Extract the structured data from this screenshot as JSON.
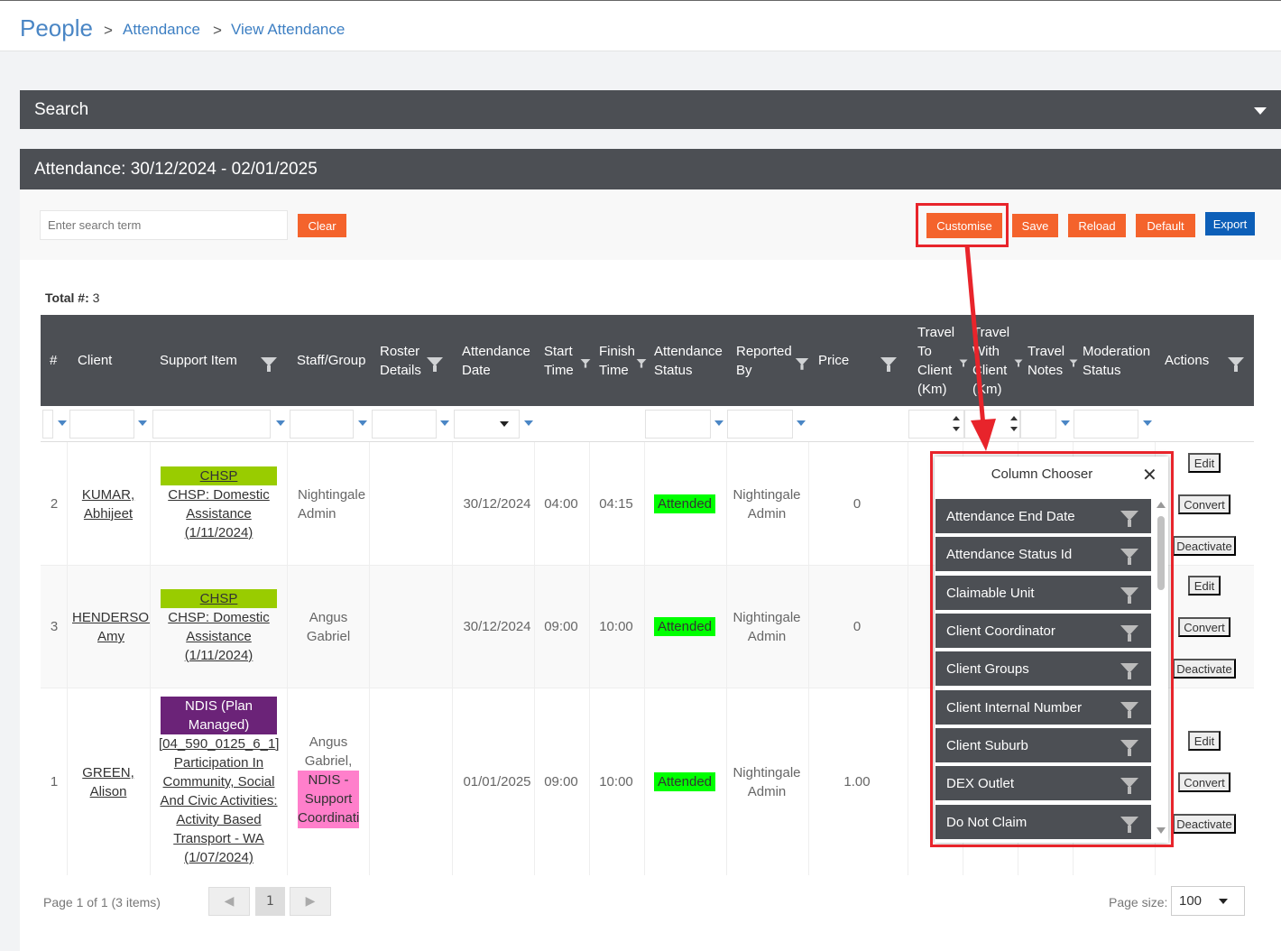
{
  "breadcrumb": {
    "root": "People",
    "items": [
      "Attendance",
      "View Attendance"
    ],
    "separator": ">"
  },
  "search_panel": {
    "title": "Search"
  },
  "attendance_panel": {
    "title": "Attendance: 30/12/2024 - 02/01/2025"
  },
  "toolbar": {
    "search_placeholder": "Enter search term",
    "clear_label": "Clear",
    "customise_label": "Customise",
    "save_label": "Save",
    "reload_label": "Reload",
    "default_label": "Default",
    "export_label": "Export"
  },
  "total": {
    "label": "Total #:",
    "value": "3"
  },
  "columns": [
    {
      "label": "#"
    },
    {
      "label": "Client"
    },
    {
      "label": "Support Item"
    },
    {
      "label": "Staff/Group"
    },
    {
      "label": "Roster Details"
    },
    {
      "label": "Attendance Date"
    },
    {
      "label": "Start Time"
    },
    {
      "label": "Finish Time"
    },
    {
      "label": "Attendance Status"
    },
    {
      "label": "Reported By"
    },
    {
      "label": "Price"
    },
    {
      "label": "Travel To Client (Km)"
    },
    {
      "label": "Travel With Client (Km)"
    },
    {
      "label": "Travel Notes"
    },
    {
      "label": "Moderation Status"
    },
    {
      "label": "Actions"
    }
  ],
  "rows": [
    {
      "num": "2",
      "client": "KUMAR, Abhijeet",
      "funding": "CHSP",
      "support": "CHSP: Domestic Assistance (1/11/2024)",
      "staff": "Nightingale Admin",
      "staff_tag": "",
      "date": "30/12/2024",
      "start": "04:00",
      "finish": "04:15",
      "status": "Attended",
      "reported": "Nightingale Admin",
      "price": "0"
    },
    {
      "num": "3",
      "client": "HENDERSON, Amy",
      "funding": "CHSP",
      "support": "CHSP: Domestic Assistance (1/11/2024)",
      "staff": "Angus Gabriel",
      "staff_tag": "",
      "date": "30/12/2024",
      "start": "09:00",
      "finish": "10:00",
      "status": "Attended",
      "reported": "Nightingale Admin",
      "price": "0"
    },
    {
      "num": "1",
      "client": "GREEN, Alison",
      "funding": "NDIS (Plan Managed)",
      "support": "[04_590_0125_6_1] Participation In Community, Social And Civic Activities: Activity Based Transport - WA (1/07/2024)",
      "staff": "Angus Gabriel,",
      "staff_tag": "NDIS - Support Coordination",
      "date": "01/01/2025",
      "start": "09:00",
      "finish": "10:00",
      "status": "Attended",
      "reported": "Nightingale Admin",
      "price": "1.00"
    }
  ],
  "actions": {
    "edit": "Edit",
    "convert": "Convert",
    "deactivate": "Deactivate"
  },
  "column_chooser": {
    "title": "Column Chooser",
    "items": [
      "Attendance End Date",
      "Attendance Status Id",
      "Claimable Unit",
      "Client Coordinator",
      "Client Groups",
      "Client Internal Number",
      "Client Suburb",
      "DEX Outlet",
      "Do Not Claim"
    ]
  },
  "pager": {
    "summary": "Page 1 of 1 (3 items)",
    "current_page": "1",
    "page_size_label": "Page size:",
    "page_size": "100"
  },
  "colors": {
    "header_bg": "#4c4f54",
    "orange": "#f4632c",
    "blue": "#0d5fb8",
    "attended": "#00ff00",
    "chsp": "#99cc00",
    "ndis": "#6b2378",
    "ndis_tag": "#ff7fcb",
    "highlight": "#e8242b"
  }
}
